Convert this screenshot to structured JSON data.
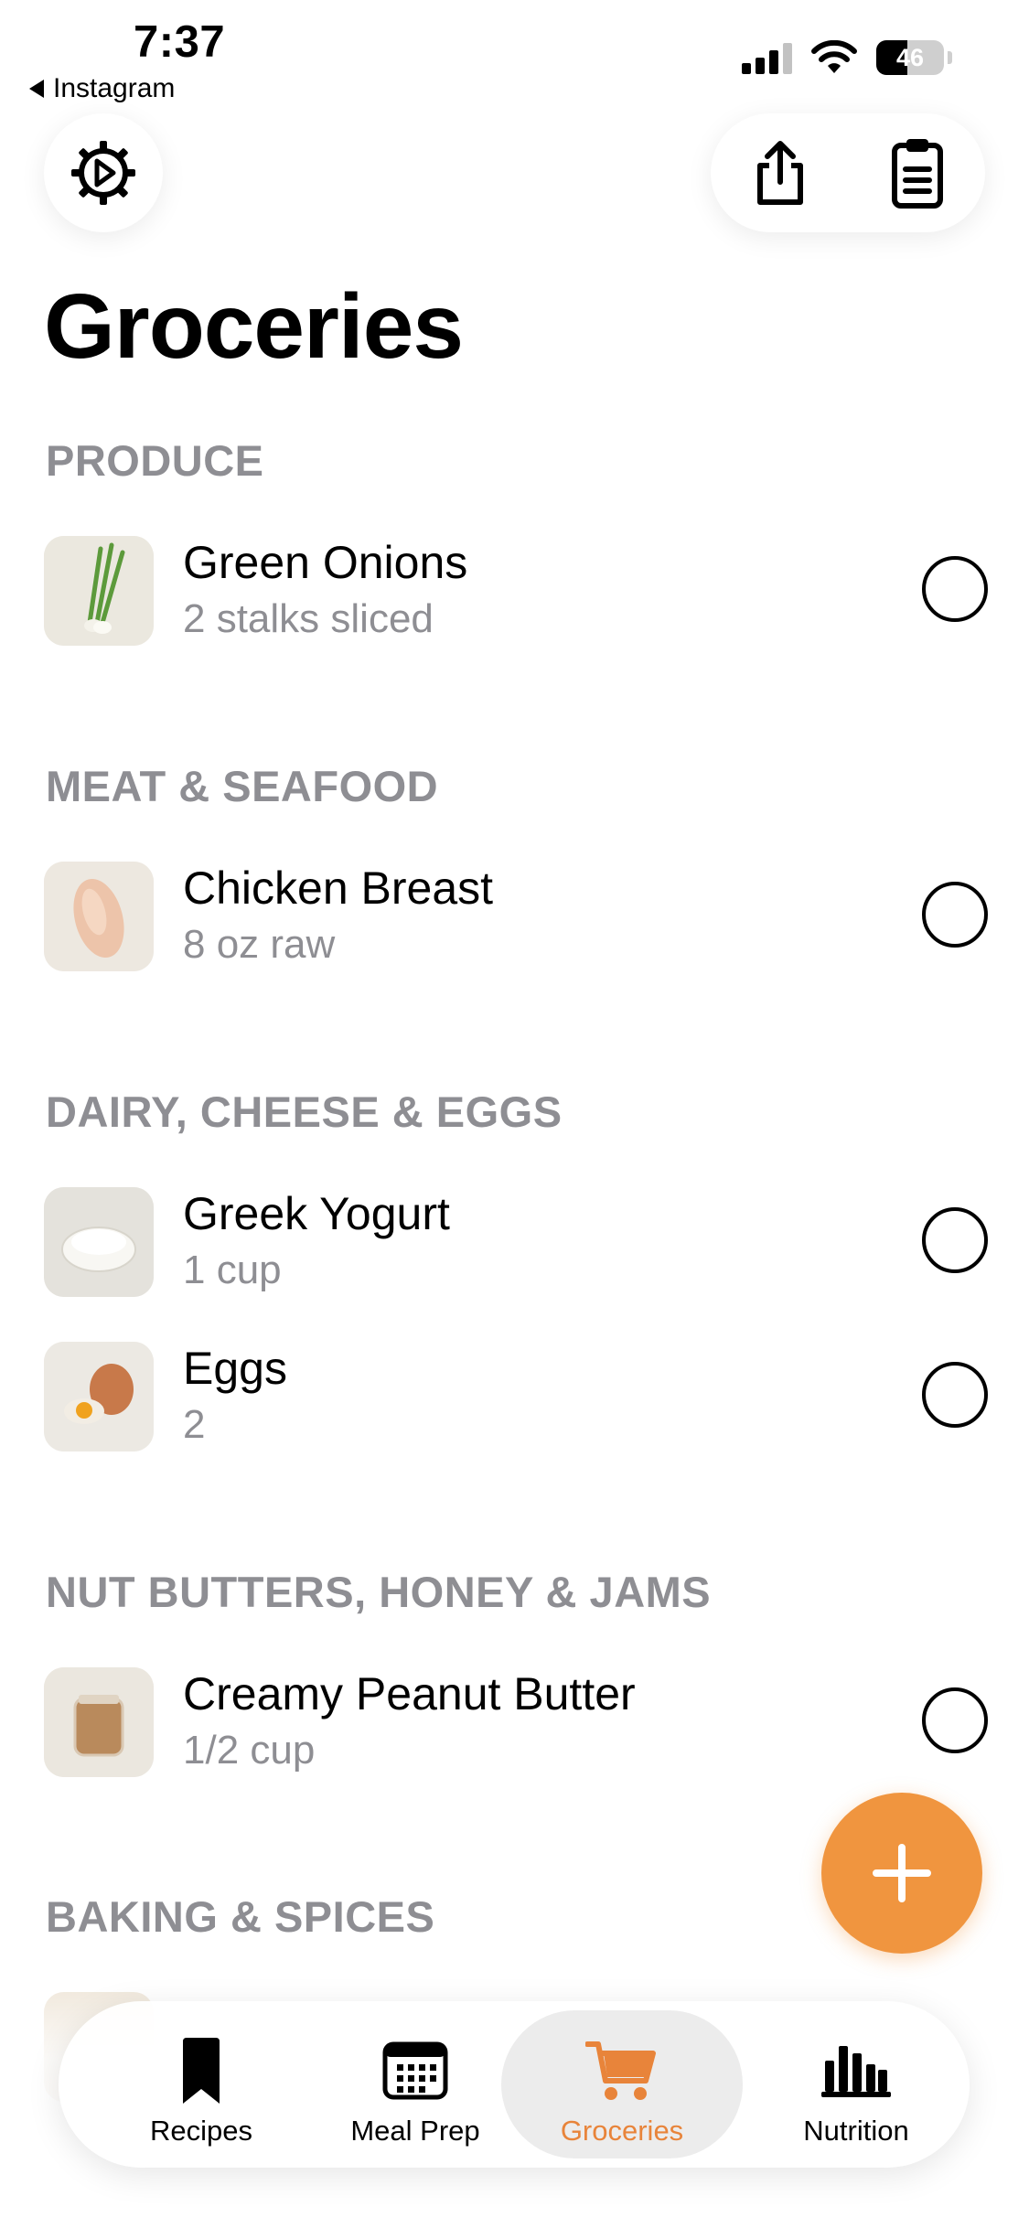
{
  "status_bar": {
    "time": "7:37",
    "back_app": "Instagram",
    "battery": "46"
  },
  "page": {
    "title": "Groceries"
  },
  "sections": [
    {
      "header": "PRODUCE",
      "items": [
        {
          "name": "Green Onions",
          "qty": "2 stalks sliced",
          "checked": false
        }
      ]
    },
    {
      "header": "MEAT & SEAFOOD",
      "items": [
        {
          "name": "Chicken Breast",
          "qty": "8 oz raw",
          "checked": false
        }
      ]
    },
    {
      "header": "DAIRY, CHEESE & EGGS",
      "items": [
        {
          "name": "Greek Yogurt",
          "qty": "1 cup",
          "checked": false
        },
        {
          "name": "Eggs",
          "qty": "2",
          "checked": false
        }
      ]
    },
    {
      "header": "NUT BUTTERS, HONEY & JAMS",
      "items": [
        {
          "name": "Creamy Peanut Butter",
          "qty": "1/2 cup",
          "checked": false
        }
      ]
    },
    {
      "header": "BAKING & SPICES",
      "items": []
    }
  ],
  "tabbar": {
    "tabs": [
      {
        "label": "Recipes",
        "icon": "bookmark-icon"
      },
      {
        "label": "Meal Prep",
        "icon": "calendar-icon"
      },
      {
        "label": "Groceries",
        "icon": "cart-icon",
        "active": true
      },
      {
        "label": "Nutrition",
        "icon": "bar-chart-icon"
      }
    ]
  },
  "colors": {
    "accent": "#f0953f",
    "section_header": "#8e8e93",
    "active_tab_label": "#e8843a"
  }
}
